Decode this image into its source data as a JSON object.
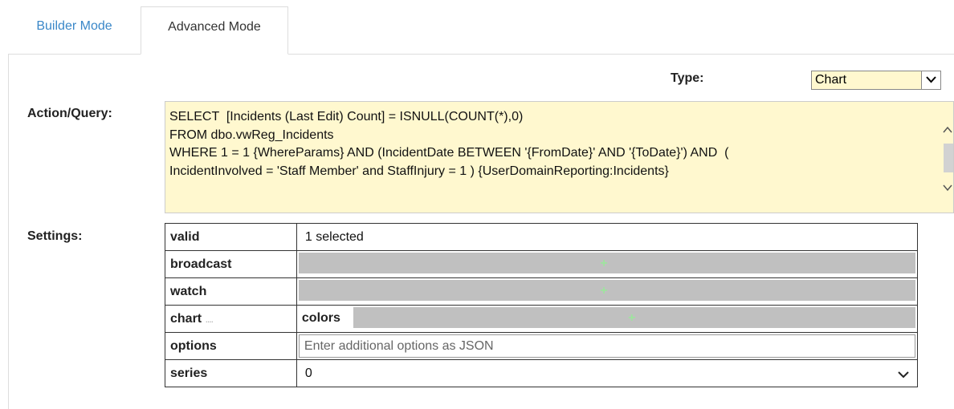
{
  "tabs": {
    "builder": "Builder Mode",
    "advanced": "Advanced Mode"
  },
  "type": {
    "label": "Type:",
    "value": "Chart"
  },
  "action": {
    "label": "Action/Query:",
    "query": "SELECT  [Incidents (Last Edit) Count] = ISNULL(COUNT(*),0)\nFROM dbo.vwReg_Incidents\nWHERE 1 = 1 {WhereParams} AND (IncidentDate BETWEEN '{FromDate}' AND '{ToDate}') AND  (\nIncidentInvolved = 'Staff Member' and StaffInjury = 1 ) {UserDomainReporting:Incidents}"
  },
  "settings": {
    "label": "Settings:",
    "rows": [
      {
        "key": "valid",
        "value": "1 selected"
      },
      {
        "key": "broadcast"
      },
      {
        "key": "watch"
      },
      {
        "key": "chart",
        "sub_label": "colors"
      },
      {
        "key": "options",
        "placeholder": "Enter additional options as JSON"
      },
      {
        "key": "series",
        "value": "0"
      }
    ]
  },
  "icons": {
    "add": "+",
    "more": "...."
  },
  "colors": {
    "tab_link": "#3a87c8",
    "query_bg": "#fff8cf",
    "gray_fill": "#c0c0c0",
    "plus": "#9fe39f"
  }
}
